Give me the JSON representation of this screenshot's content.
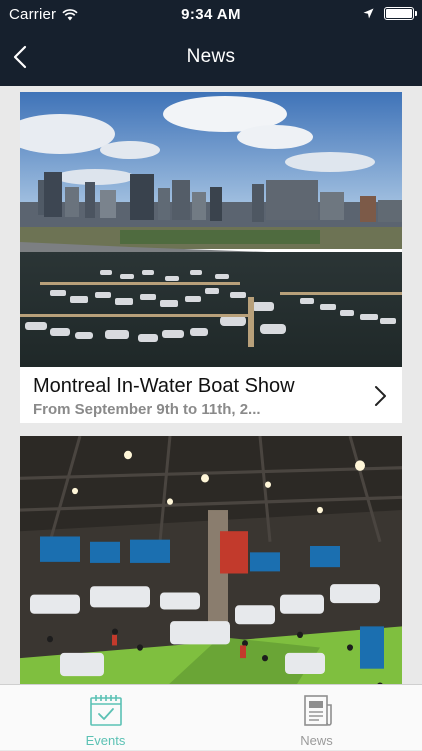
{
  "status_bar": {
    "carrier": "Carrier",
    "time": "9:34 AM",
    "battery_level": 1.0
  },
  "nav": {
    "title": "News"
  },
  "news": [
    {
      "title": "Montreal In-Water Boat Show",
      "subtitle": "From September 9th to 11th, 2..."
    }
  ],
  "tabs": [
    {
      "label": "Events",
      "icon": "calendar-check-icon",
      "active": true
    },
    {
      "label": "News",
      "icon": "newspaper-icon",
      "active": false
    }
  ],
  "colors": {
    "header_bg": "#16202d",
    "accent": "#5bc1b4",
    "inactive": "#9a9a9a",
    "background": "#e9e9e9"
  }
}
